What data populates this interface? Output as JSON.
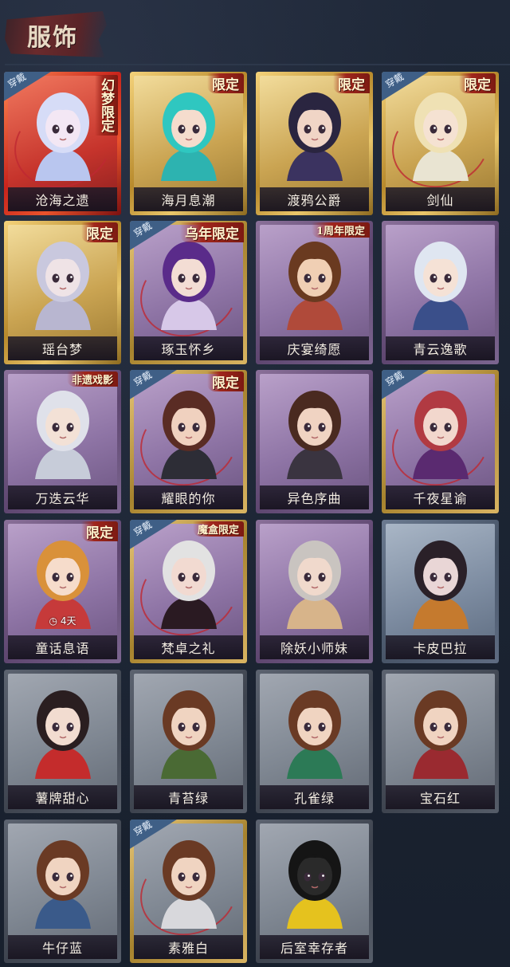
{
  "header": {
    "title": "服饰"
  },
  "cards": [
    {
      "name": "沧海之遗",
      "frame": "red",
      "wearing": true,
      "tag": "幻梦限定",
      "tag_style": "vertical",
      "hair": "#d6dcf7",
      "skin": "#f3e7f4",
      "outfit": "#b9c6ef"
    },
    {
      "name": "海月息潮",
      "frame": "gold",
      "wearing": false,
      "tag": "限定",
      "hair": "#2fc7c0",
      "skin": "#f5dccd",
      "outfit": "#2db3b0"
    },
    {
      "name": "渡鸦公爵",
      "frame": "gold",
      "wearing": false,
      "tag": "限定",
      "hair": "#2a2540",
      "skin": "#f0d5c6",
      "outfit": "#3b3360"
    },
    {
      "name": "剑仙",
      "frame": "gold",
      "wearing": true,
      "tag": "限定",
      "hair": "#efe1b4",
      "skin": "#f5e2d2",
      "outfit": "#e9e4d2"
    },
    {
      "name": "瑶台梦",
      "frame": "gold",
      "wearing": false,
      "tag": "限定",
      "hair": "#c9c8de",
      "skin": "#efe3e6",
      "outfit": "#b8b6d0"
    },
    {
      "name": "琢玉怀乡",
      "frame": "purpleg",
      "wearing": true,
      "tag": "乌年限定",
      "hair": "#5a2b8a",
      "skin": "#f3ddd4",
      "outfit": "#d7c8e8"
    },
    {
      "name": "庆宴绮愿",
      "frame": "purple",
      "wearing": false,
      "tag": "1周年限定",
      "tag_style": "small",
      "hair": "#6a3a20",
      "skin": "#f0cfb4",
      "outfit": "#b04a3a"
    },
    {
      "name": "青云逸歌",
      "frame": "purple",
      "wearing": false,
      "tag": "",
      "hair": "#dfe6f1",
      "skin": "#f5e2d6",
      "outfit": "#3a4f8a"
    },
    {
      "name": "万迭云华",
      "frame": "purple",
      "wearing": false,
      "tag": "非遗戏影",
      "tag_style": "small",
      "hair": "#dfe1ea",
      "skin": "#f3e1d6",
      "outfit": "#c7ccd9"
    },
    {
      "name": "耀眼的你",
      "frame": "purpleg",
      "wearing": true,
      "tag": "限定",
      "hair": "#5a2c24",
      "skin": "#f0d1bf",
      "outfit": "#2d2d36"
    },
    {
      "name": "异色序曲",
      "frame": "purple",
      "wearing": false,
      "tag": "",
      "hair": "#4a2a20",
      "skin": "#f0d3c2",
      "outfit": "#3a3440"
    },
    {
      "name": "千夜星谕",
      "frame": "purpleg",
      "wearing": true,
      "tag": "",
      "hair": "#b13a42",
      "skin": "#f2d7cd",
      "outfit": "#5a2a70"
    },
    {
      "name": "童话息语",
      "frame": "purple",
      "wearing": false,
      "tag": "限定",
      "timer": "4天",
      "hair": "#d9913a",
      "skin": "#f6dccb",
      "outfit": "#c63a3a"
    },
    {
      "name": "梵卓之礼",
      "frame": "purpleg",
      "wearing": true,
      "tag": "魔盒限定",
      "tag_style": "small",
      "hair": "#e2e2e2",
      "skin": "#f2dad1",
      "outfit": "#2a1a22"
    },
    {
      "name": "除妖小师妹",
      "frame": "purple",
      "wearing": false,
      "tag": "",
      "hair": "#c9c4c0",
      "skin": "#f0d9cc",
      "outfit": "#d7b48a"
    },
    {
      "name": "卡皮巴拉",
      "frame": "blue",
      "wearing": false,
      "tag": "",
      "hair": "#2a2028",
      "skin": "#e9d6d6",
      "outfit": "#c57a2e"
    },
    {
      "name": "薯牌甜心",
      "frame": "gray",
      "wearing": false,
      "tag": "",
      "hair": "#2a1e20",
      "skin": "#f2dcd0",
      "outfit": "#c42c2c"
    },
    {
      "name": "青苔绿",
      "frame": "gray",
      "wearing": false,
      "tag": "",
      "hair": "#6a3a24",
      "skin": "#f0d4c1",
      "outfit": "#4a6a34"
    },
    {
      "name": "孔雀绿",
      "frame": "gray",
      "wearing": false,
      "tag": "",
      "hair": "#6a3a24",
      "skin": "#f0d4c1",
      "outfit": "#2c7a56"
    },
    {
      "name": "宝石红",
      "frame": "gray",
      "wearing": false,
      "tag": "",
      "hair": "#6a3a24",
      "skin": "#f0d4c1",
      "outfit": "#9a2a30"
    },
    {
      "name": "牛仔蓝",
      "frame": "gray",
      "wearing": false,
      "tag": "",
      "hair": "#6a3a24",
      "skin": "#f0d4c1",
      "outfit": "#3a5a8a"
    },
    {
      "name": "素雅白",
      "frame": "graygold",
      "wearing": true,
      "tag": "",
      "hair": "#6a3a24",
      "skin": "#f0d4c1",
      "outfit": "#d8d8dc"
    },
    {
      "name": "后室幸存者",
      "frame": "gray",
      "wearing": false,
      "tag": "",
      "hair": "#151515",
      "skin": "#2a2a2a",
      "outfit": "#e5c21e"
    }
  ],
  "labels": {
    "wearing": "穿戴"
  }
}
